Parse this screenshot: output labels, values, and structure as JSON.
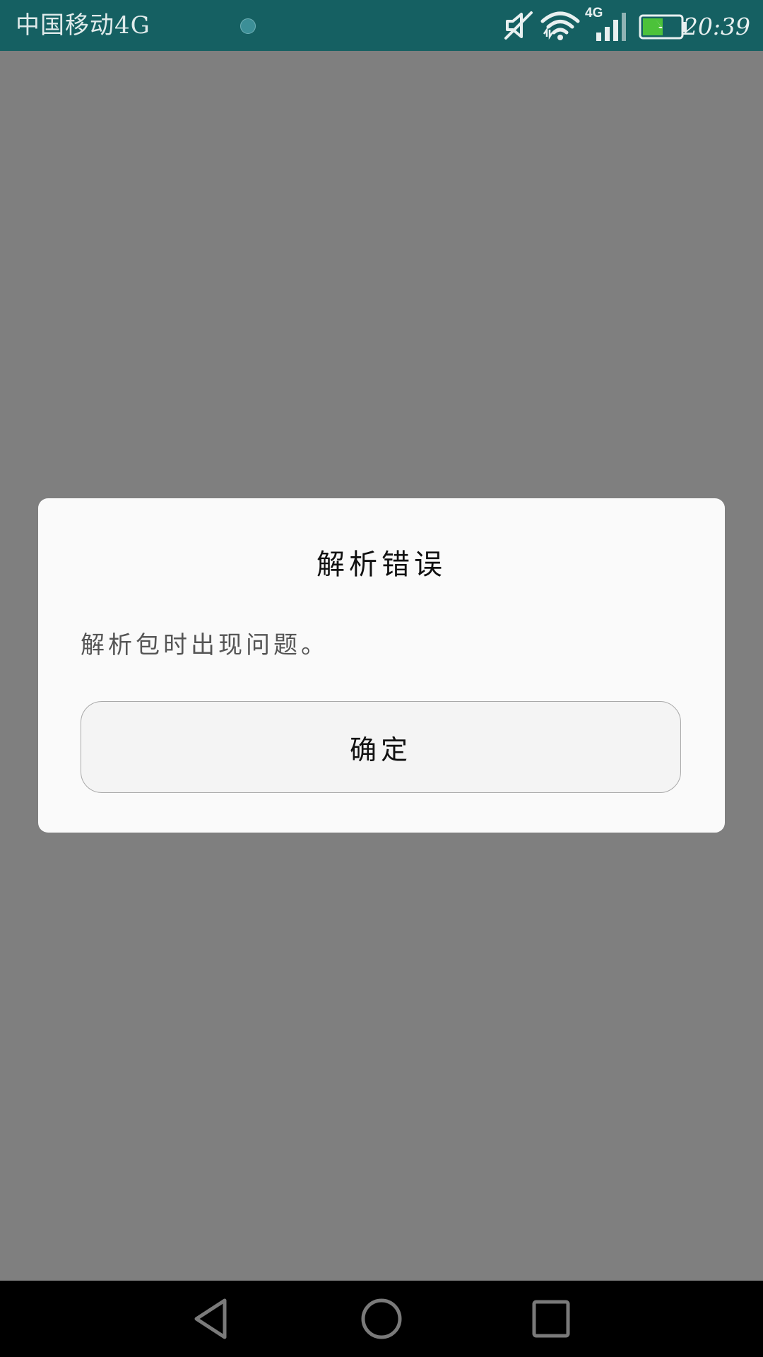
{
  "status_bar": {
    "carrier": "中国移动4G",
    "network_badge": "4G",
    "time": "20:39",
    "icons": [
      "notification-dot-icon",
      "mute-icon",
      "wifi-icon",
      "signal-icon",
      "battery-charging-icon"
    ],
    "background_color": "#156062"
  },
  "dialog": {
    "title": "解析错误",
    "message": "解析包时出现问题。",
    "ok_label": "确定"
  },
  "nav_bar": {
    "icons": [
      "back-icon",
      "home-icon",
      "recents-icon"
    ]
  },
  "colors": {
    "overlay": "#7f7f7f",
    "dialog_bg": "#fafafa",
    "button_bg": "#f4f4f4"
  }
}
